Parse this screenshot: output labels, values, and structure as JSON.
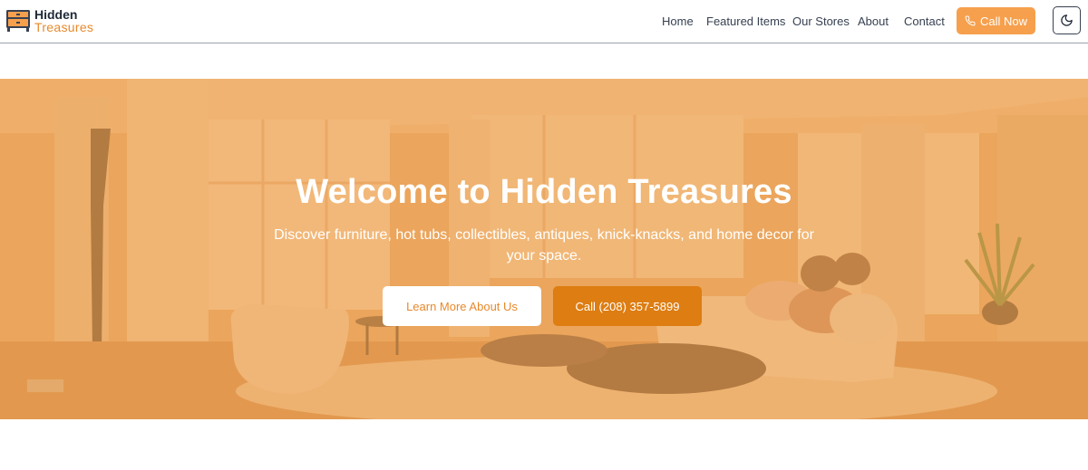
{
  "brand": {
    "line1": "Hidden",
    "line2": "Treasures",
    "icon": "dresser-icon",
    "accent_color": "#e8892b"
  },
  "nav": {
    "items": [
      {
        "label": "Home"
      },
      {
        "label": "Featured Items"
      },
      {
        "label": "Our Stores"
      },
      {
        "label": "About"
      },
      {
        "label": "Contact"
      }
    ],
    "call_label": "Call Now",
    "call_icon": "phone-icon",
    "call_color": "#f6a04d",
    "theme_icon": "moon-icon"
  },
  "hero": {
    "title": "Welcome to Hidden Treasures",
    "subtitle": "Discover furniture, hot tubs, collectibles, antiques, knick-knacks, and home decor for your space.",
    "primary_button": "Learn More About Us",
    "secondary_button": "Call (208) 357-5899",
    "secondary_color": "#dd7d12",
    "background": "living-room-photo"
  }
}
